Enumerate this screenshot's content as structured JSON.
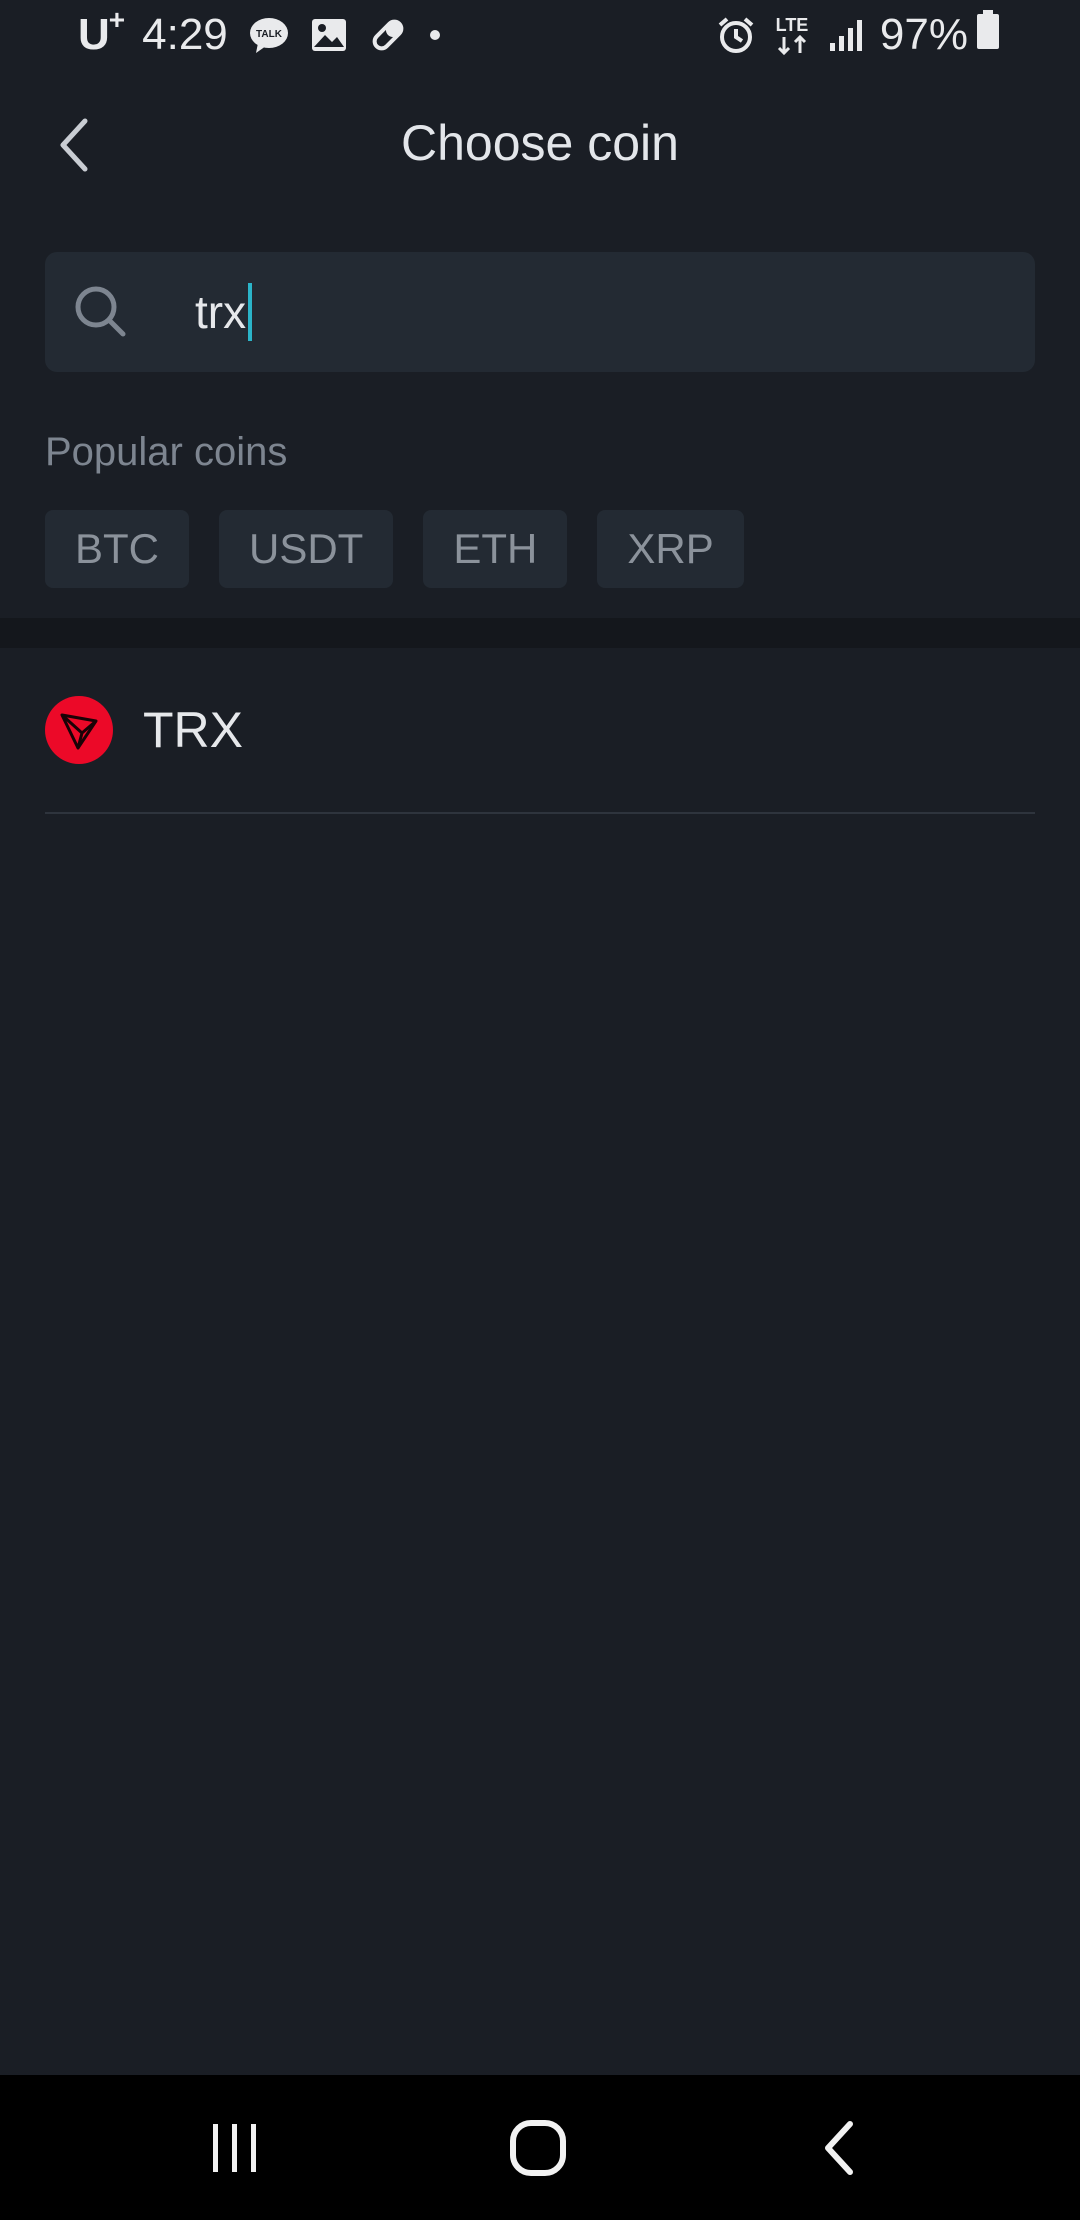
{
  "status_bar": {
    "carrier": "U",
    "carrier_sup": "+",
    "time": "4:29",
    "left_icons": [
      "talk-icon",
      "gallery-icon",
      "pill-icon",
      "dot-icon"
    ],
    "talk_badge": "TALK",
    "right_icons": [
      "alarm-icon",
      "lte-icon",
      "signal-icon",
      "battery-icon"
    ],
    "network": "LTE",
    "battery": "97%"
  },
  "header": {
    "title": "Choose coin",
    "back_icon": "chevron-left-icon"
  },
  "search": {
    "value": "trx",
    "icon": "search-icon"
  },
  "popular": {
    "label": "Popular coins",
    "coins": [
      "BTC",
      "USDT",
      "ETH",
      "XRP"
    ]
  },
  "results": [
    {
      "symbol": "TRX",
      "icon": "tron-icon",
      "icon_color": "#ec0928"
    }
  ],
  "nav_bar": {
    "buttons": [
      "recent-apps-icon",
      "home-icon",
      "back-icon"
    ]
  },
  "colors": {
    "background": "#1a1e25",
    "surface": "#232a33",
    "accent_caret": "#2bb4c9",
    "muted_text": "#7d8590"
  }
}
